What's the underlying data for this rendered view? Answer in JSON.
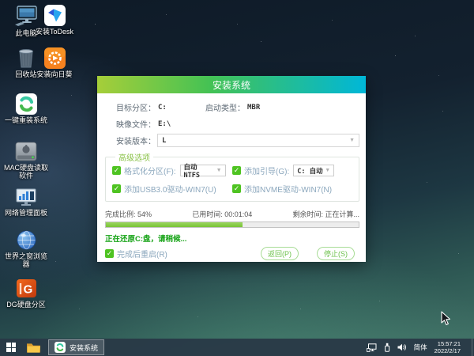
{
  "desktop": {
    "icons": [
      {
        "label": "此电脑"
      },
      {
        "label": "安装ToDesk"
      },
      {
        "label": "回收站"
      },
      {
        "label": "安装向日葵"
      },
      {
        "label": "一键重装系统"
      },
      {
        "label": "MAC硬盘读取软件"
      },
      {
        "label": "网络管理面板"
      },
      {
        "label": "世界之窗浏览器"
      },
      {
        "label": "DG硬盘分区"
      }
    ]
  },
  "dialog": {
    "title": "安装系统",
    "fields": {
      "target_partition_label": "目标分区：",
      "target_partition_value": "C:",
      "boot_type_label": "启动类型：",
      "boot_type_value": "MBR",
      "image_file_label": "映像文件：",
      "image_file_value": "E:\\",
      "install_version_label": "安装版本：",
      "install_version_value": "L"
    },
    "advanced": {
      "legend": "高级选项",
      "format_label": "格式化分区(F):",
      "format_value": "自动 NTFS",
      "boot_label": "添加引导(G):",
      "boot_value": "C: 自动",
      "usb_label": "添加USB3.0驱动-WIN7(U)",
      "nvme_label": "添加NVME驱动-WIN7(N)"
    },
    "progress": {
      "percent": 54,
      "percent_text": "完成比例: 54%",
      "elapsed_text": "已用时间: 00:01:04",
      "remaining_text": "剩余时间: 正在计算...",
      "status": "正在还原C:盘，请稍候..."
    },
    "footer": {
      "reboot_label": "完成后重启(R)",
      "back_button": "返回(P)",
      "stop_button": "停止(S)"
    }
  },
  "taskbar": {
    "task_label": "安装系统",
    "ime": "简体",
    "time": "15:57:21",
    "date": "2022/2/17"
  },
  "ui": {
    "check_glyph": "✓",
    "arrow_glyph": "▼"
  },
  "colors": {
    "title_gradient_left": "#a6ce39",
    "title_gradient_right": "#00b7d8",
    "checkbox_green": "#4ec321",
    "progress_green": "#79c337",
    "status_green": "#16a316",
    "button_green": "#6cc14b",
    "taskbar_bg": "#283846"
  }
}
